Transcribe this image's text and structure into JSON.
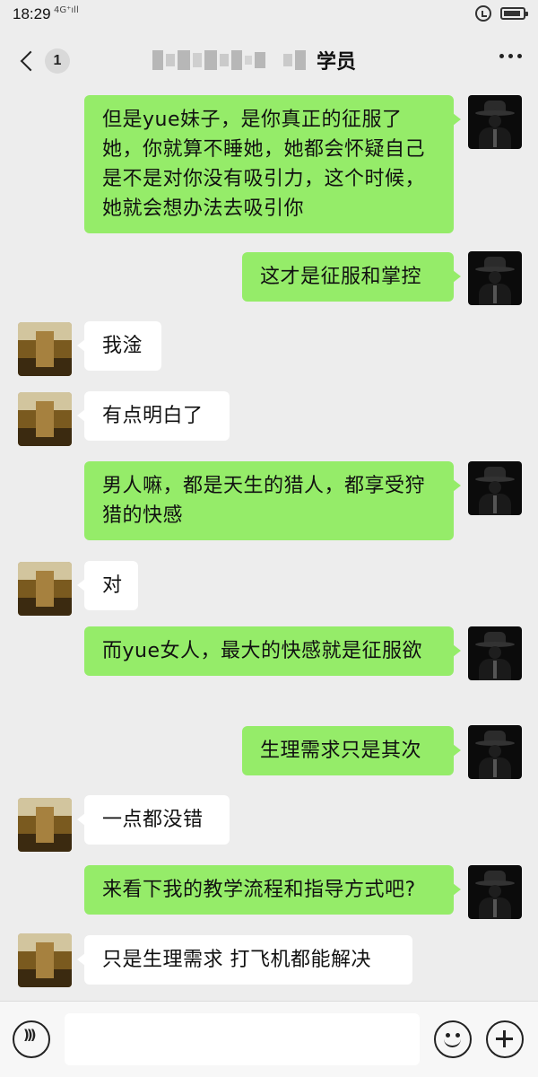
{
  "status_bar": {
    "time": "18:29",
    "signal": "4G⁺ıll",
    "icons": [
      "alarm-icon",
      "battery-icon"
    ]
  },
  "header": {
    "unread_count": "1",
    "title": "学员",
    "title_obscured": true,
    "icons": [
      "back-chevron-icon",
      "more-dots-icon"
    ]
  },
  "messages": [
    {
      "sender": "self",
      "text": "但是yue妹子，是你真正的征服了她，你就算不睡她，她都会怀疑自己是不是对你没有吸引力，这个时候，她就会想办法去吸引你"
    },
    {
      "sender": "self",
      "text": "这才是征服和掌控"
    },
    {
      "sender": "other",
      "text": "我淦"
    },
    {
      "sender": "other",
      "text": "有点明白了"
    },
    {
      "sender": "self",
      "text": "男人嘛，都是天生的猎人，都享受狩猎的快感"
    },
    {
      "sender": "other",
      "text": "对"
    },
    {
      "sender": "self",
      "text": "而yue女人，最大的快感就是征服欲"
    },
    {
      "sender": "self",
      "text": "生理需求只是其次"
    },
    {
      "sender": "other",
      "text": "一点都没错"
    },
    {
      "sender": "self",
      "text": "来看下我的教学流程和指导方式吧?"
    },
    {
      "sender": "other",
      "text": "只是生理需求 打飞机都能解决"
    }
  ],
  "input_bar": {
    "value": "",
    "icons": [
      "voice-icon",
      "emoji-icon",
      "plus-icon"
    ]
  },
  "colors": {
    "background": "#ededed",
    "self_bubble": "#95ec69",
    "other_bubble": "#ffffff"
  }
}
